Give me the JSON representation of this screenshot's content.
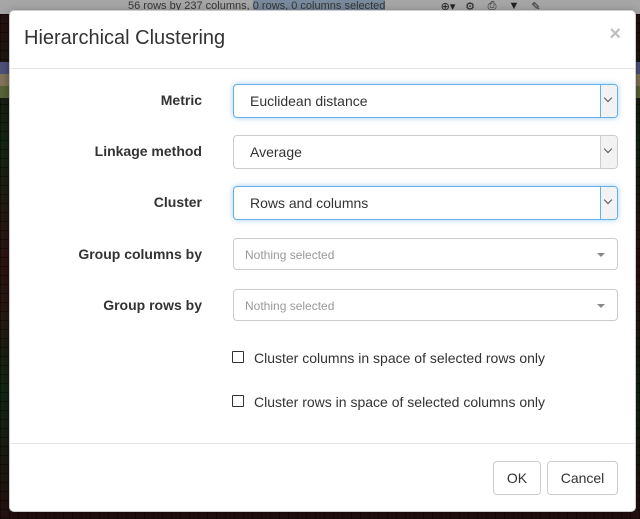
{
  "background": {
    "status_text_a": "56 rows by 237 columns",
    "status_text_b": "0 rows, 0 columns selected",
    "icons": [
      "zoom-icon",
      "gear-icon",
      "file-icon",
      "filter-icon",
      "tag-icon"
    ],
    "icon_glyphs": [
      "⊕▾",
      "⚙",
      "⎙",
      "▼",
      "✎"
    ],
    "band_colors": [
      "#7b7fbf",
      "#c9b58c",
      "#8c9a58",
      "#b9b38e"
    ]
  },
  "dialog": {
    "title": "Hierarchical Clustering",
    "close_glyph": "×",
    "fields": {
      "metric": {
        "label": "Metric",
        "value": "Euclidean distance"
      },
      "linkage": {
        "label": "Linkage method",
        "value": "Average"
      },
      "cluster": {
        "label": "Cluster",
        "value": "Rows and columns"
      },
      "group_columns": {
        "label": "Group columns by",
        "placeholder": "Nothing selected"
      },
      "group_rows": {
        "label": "Group rows by",
        "placeholder": "Nothing selected"
      }
    },
    "checkboxes": {
      "cols_selected_rows": {
        "label": "Cluster columns in space of selected rows only",
        "checked": false
      },
      "rows_selected_cols": {
        "label": "Cluster rows in space of selected columns only",
        "checked": false
      }
    },
    "buttons": {
      "ok": "OK",
      "cancel": "Cancel"
    }
  },
  "colors": {
    "focus_border": "#66afe9",
    "text": "#333333",
    "placeholder": "#999999"
  }
}
